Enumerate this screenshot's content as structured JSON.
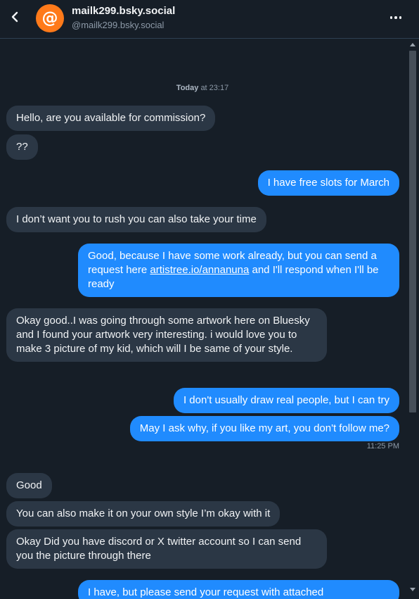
{
  "header": {
    "title": "mailk299.bsky.social",
    "handle": "@mailk299.bsky.social",
    "avatar_glyph": "@"
  },
  "divider": {
    "date": "Today",
    "at": "at 23:17"
  },
  "messages": [
    {
      "from": "them",
      "text": "Hello, are you available for commission?"
    },
    {
      "from": "them",
      "text": "??"
    },
    {
      "from": "me",
      "text": "I have free slots for March"
    },
    {
      "from": "them",
      "text": "I don’t want you to rush you can also take your time"
    },
    {
      "from": "me",
      "text_before": "Good, because I have some work already, but you can send a request here ",
      "link": "artistree.io/annanuna",
      "text_after": " and I'll respond when I'll be ready"
    },
    {
      "from": "them",
      "text": "Okay good..I was going through some artwork here on Bluesky and I found your artwork very interesting. i would love you to make 3 picture of my kid, which will I be same of your style."
    },
    {
      "from": "me",
      "text": "I don't usually draw real people, but I can try"
    },
    {
      "from": "me",
      "text": "May I ask why, if you like my art, you don't follow me?"
    },
    {
      "from": "meta",
      "text": "11:25 PM"
    },
    {
      "from": "them",
      "text": "Good"
    },
    {
      "from": "them",
      "text": "You can also make it on your own style I’m okay with it"
    },
    {
      "from": "them",
      "text": "Okay Did you have discord or X twitter account so I can send you the picture through there"
    },
    {
      "from": "me",
      "text": "I have, but please send your request with attached"
    }
  ],
  "colors": {
    "background": "#161e27",
    "incoming_bubble": "#2b3745",
    "outgoing_bubble": "#208bfe",
    "avatar": "#ff7a1a"
  },
  "icons": {
    "back": "chevron-left-icon",
    "more": "ellipsis-horizontal-icon"
  }
}
